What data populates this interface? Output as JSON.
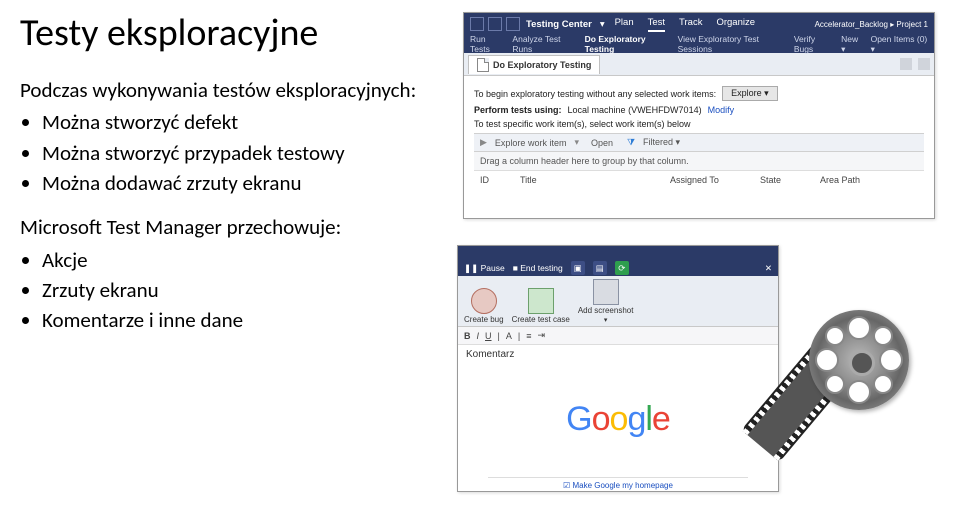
{
  "title": "Testy eksploracyjne",
  "section1": {
    "heading": "Podczas wykonywania testów eksploracyjnych:",
    "items": [
      "Można stworzyć defekt",
      "Można stworzyć przypadek testowy",
      "Można dodawać zrzuty ekranu"
    ]
  },
  "section2": {
    "heading": "Microsoft Test Manager przechowuje:",
    "items": [
      "Akcje",
      "Zrzuty ekranu",
      "Komentarze i inne dane"
    ]
  },
  "tc": {
    "center_label": "Testing Center",
    "main_tabs": [
      "Plan",
      "Test",
      "Track",
      "Organize"
    ],
    "main_tabs_active_index": 1,
    "project_label": "Accelerator_Backlog ▸ Project 1",
    "sub_tabs": [
      "Run Tests",
      "Analyze Test Runs",
      "Do Exploratory Testing",
      "View Exploratory Test Sessions",
      "Verify Bugs"
    ],
    "sub_tabs_active_index": 2,
    "sub_right": [
      "New ▾",
      "Open Items (0) ▾"
    ],
    "tab_title": "Do Exploratory Testing",
    "intro_text": "To begin exploratory testing without any selected work items:",
    "explore_btn": "Explore ▾",
    "perform_label": "Perform tests using:",
    "perform_value": "Local machine (VWEHFDW7014)",
    "modify_link": "Modify",
    "select_text": "To test specific work item(s), select work item(s) below",
    "toolbar_explore": "Explore work item",
    "toolbar_open": "Open",
    "toolbar_filter": "Filtered ▾",
    "group_hint": "Drag a column header here to group by that column.",
    "columns": [
      "ID",
      "Title",
      "Assigned To",
      "State",
      "Area Path"
    ]
  },
  "tr": {
    "pause": "Pause",
    "end": "End testing",
    "btn_bug": "Create bug",
    "btn_case": "Create test case",
    "btn_shot": "Add screenshot",
    "fmt_b": "B",
    "fmt_i": "I",
    "fmt_u": "U",
    "fmt_a": "A",
    "comment_label": "Komentarz",
    "google_g1": "G",
    "google_o1": "o",
    "google_o2": "o",
    "google_g2": "g",
    "google_l": "l",
    "google_e": "e",
    "footer_text": "Make Google my homepage"
  }
}
